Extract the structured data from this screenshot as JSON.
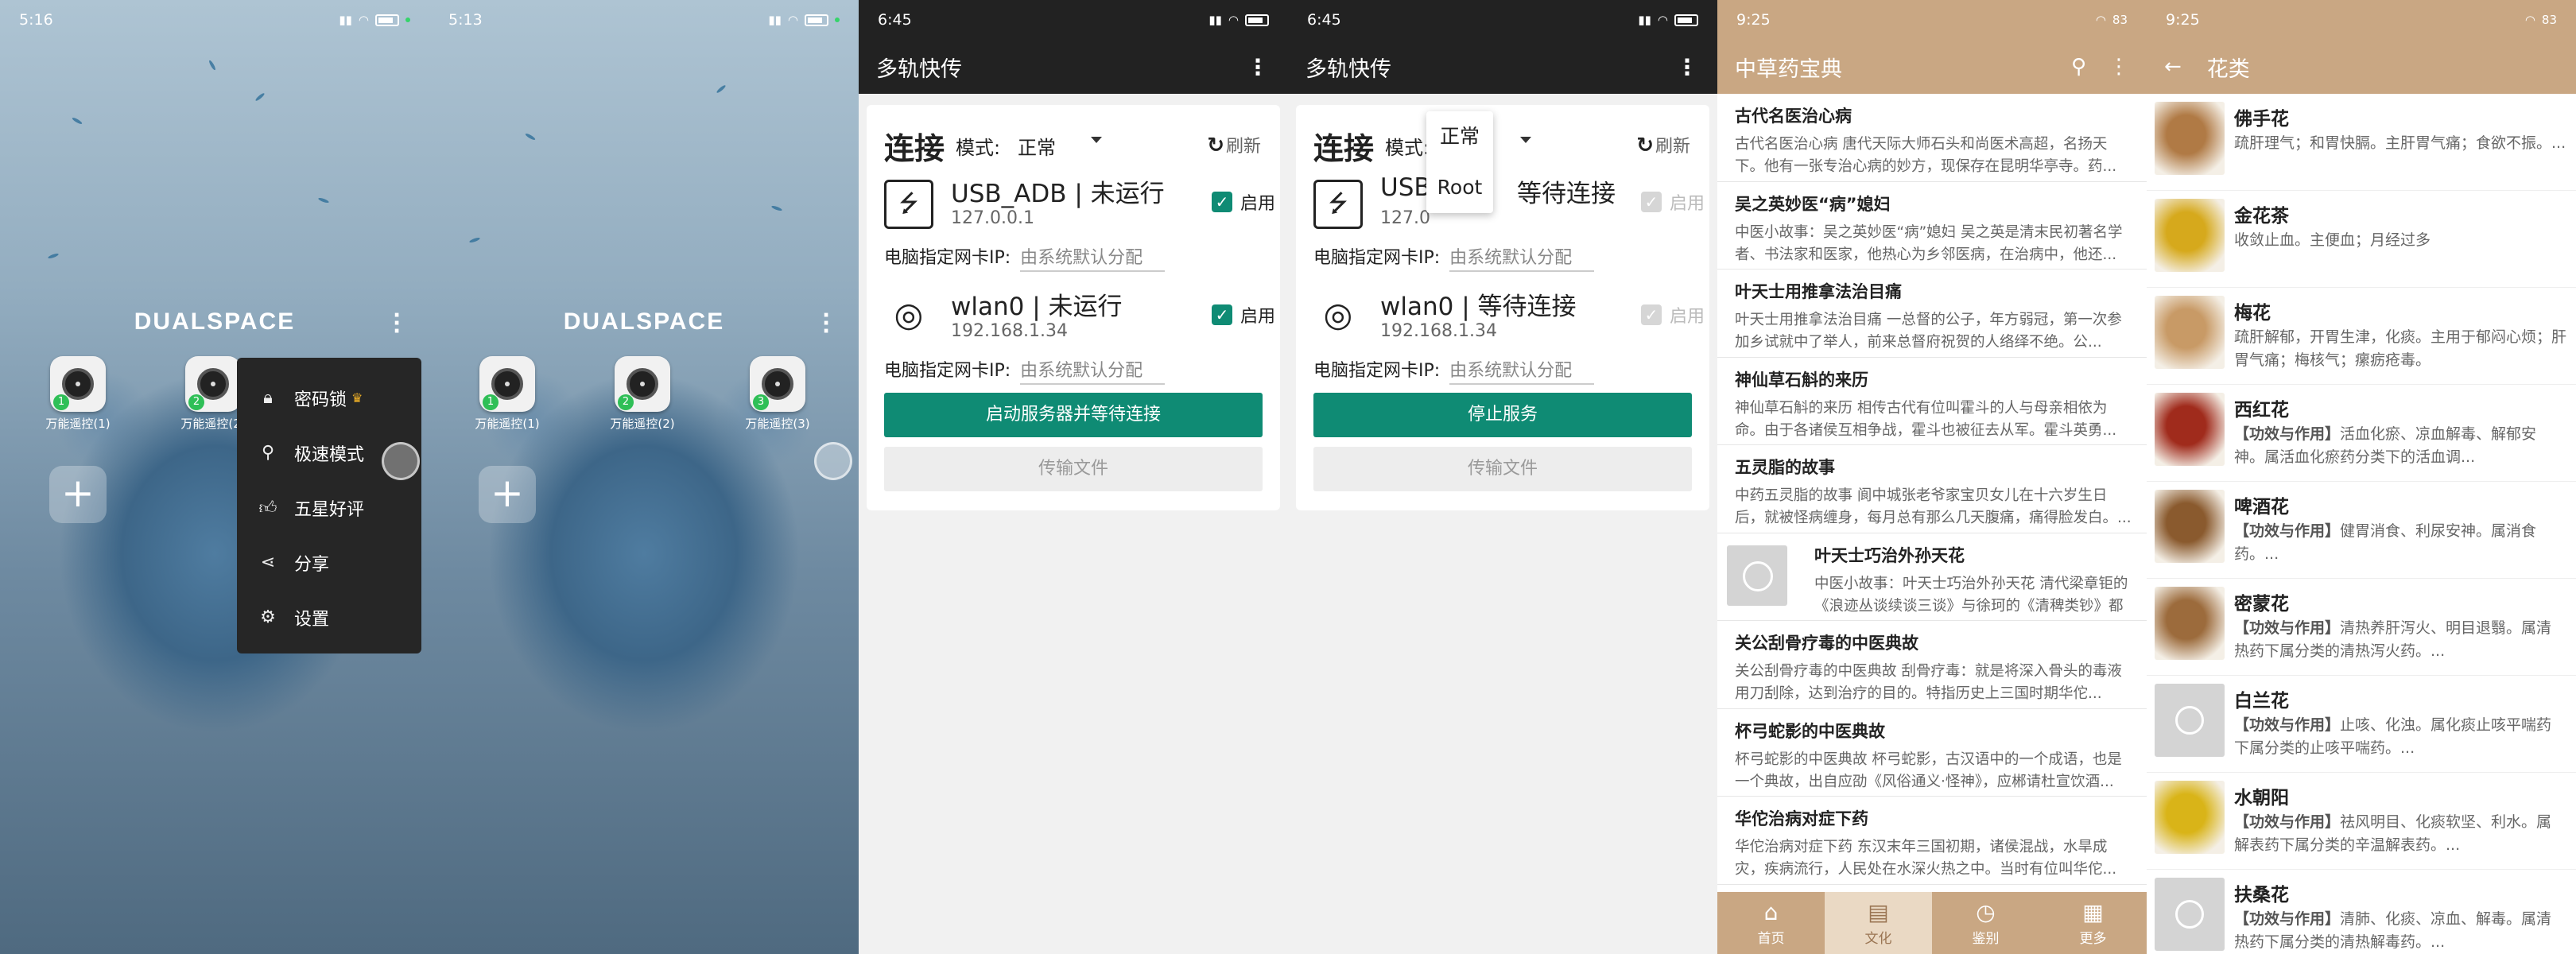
{
  "ds1": {
    "status_time": "5:16",
    "title": "DUALSPACE",
    "apps": [
      "万能遥控(1)",
      "万能遥控(2)"
    ],
    "badges": [
      "1",
      "2"
    ],
    "menu": [
      {
        "label": "密码锁",
        "icon": "lock-icon"
      },
      {
        "label": "极速模式",
        "icon": "rocket-icon"
      },
      {
        "label": "五星好评",
        "icon": "thumbs-up-icon"
      },
      {
        "label": "分享",
        "icon": "share-icon"
      },
      {
        "label": "设置",
        "icon": "settings-icon"
      }
    ]
  },
  "ds2": {
    "status_time": "5:13",
    "title": "DUALSPACE",
    "apps": [
      "万能遥控(1)",
      "万能遥控(2)",
      "万能遥控(3)"
    ],
    "badges": [
      "1",
      "2",
      "3"
    ]
  },
  "mt1": {
    "status_time": "6:45",
    "app_title": "多轨快传",
    "conn_title": "连接",
    "mode_label": "模式:",
    "mode_value": "正常",
    "refresh": "刷新",
    "usb": {
      "name": "USB_ADB | 未运行",
      "ip": "127.0.0.1",
      "enable": "启用"
    },
    "wlan": {
      "name": "wlan0 | 未运行",
      "ip": "192.168.1.34",
      "enable": "启用"
    },
    "nic_label": "电脑指定网卡IP:",
    "nic_value": "由系统默认分配",
    "primary_button": "启动服务器并等待连接",
    "secondary_button": "传输文件"
  },
  "mt2": {
    "status_time": "6:45",
    "app_title": "多轨快传",
    "conn_title": "连接",
    "mode_label": "模式:",
    "refresh": "刷新",
    "mode_options": [
      "正常",
      "Root"
    ],
    "usb": {
      "name_prefix": "USB_",
      "name_suffix": "等待连接",
      "ip": "127.0",
      "enable": "启用"
    },
    "wlan": {
      "name": "wlan0 | 等待连接",
      "ip": "192.168.1.34",
      "enable": "启用"
    },
    "nic_label": "电脑指定网卡IP:",
    "nic_value": "由系统默认分配",
    "primary_button": "停止服务",
    "secondary_button": "传输文件"
  },
  "herb1": {
    "status_time": "9:25",
    "status_batt": "83",
    "app_title": "中草药宝典",
    "articles": [
      {
        "title": "古代名医治心病",
        "desc": "古代名医治心病 唐代天际大师石头和尚医术高超，名扬天下。他有一张专治心病的妙方，现保存在昆明华亭寺。药..."
      },
      {
        "title": "吴之英妙医“病”媳妇",
        "desc": "中医小故事：吴之英妙医“病”媳妇 吴之英是清末民初著名学者、书法家和医家，他热心为乡邻医病，在治病中，他还..."
      },
      {
        "title": "叶天士用推拿法治目痛",
        "desc": "叶天士用推拿法治目痛 一总督的公子，年方弱冠，第一次参加乡试就中了举人，前来总督府祝贺的人络绎不绝。公..."
      },
      {
        "title": "神仙草石斛的来历",
        "desc": "神仙草石斛的来历 相传古代有位叫霍斗的人与母亲相依为命。由于各诸侯互相争战，霍斗也被征去从军。霍斗英勇..."
      },
      {
        "title": "五灵脂的故事",
        "desc": "中药五灵脂的故事 阆中城张老爷家宝贝女儿在十六岁生日后，就被怪病缠身，每月总有那么几天腹痛，痛得脸发白。..."
      },
      {
        "title": "叶天士巧治外孙天花",
        "desc": "中医小故事：叶天士巧治外孙天花 清代梁章钜的《浪迹丛谈续谈三谈》与徐珂的《清稗类钞》都记..."
      },
      {
        "title": "关公刮骨疗毒的中医典故",
        "desc": "关公刮骨疗毒的中医典故 刮骨疗毒：就是将深入骨头的毒液用刀刮除，达到治疗的目的。特指历史上三国时期华佗..."
      },
      {
        "title": "杯弓蛇影的中医典故",
        "desc": "杯弓蛇影的中医典故 杯弓蛇影，古汉语中的一个成语，也是一个典故，出自应劭《风俗通义·怪神》，应郴请杜宣饮酒..."
      },
      {
        "title": "华佗治病对症下药",
        "desc": "华佗治病对症下药 东汉末年三国初期，诸侯混战，水旱成灾，疾病流行，人民处在水深火热之中。当时有位叫华佗..."
      }
    ],
    "tabs": [
      {
        "label": "首页",
        "icon": "home-icon"
      },
      {
        "label": "文化",
        "icon": "book-icon"
      },
      {
        "label": "鉴别",
        "icon": "compass-icon"
      },
      {
        "label": "更多",
        "icon": "grid-icon"
      }
    ]
  },
  "herb2": {
    "status_time": "9:25",
    "status_batt": "83",
    "app_title": "花类",
    "flowers": [
      {
        "name": "佛手花",
        "effect_tag": "",
        "desc": "疏肝理气；和胃快膈。主肝胃气痛；食欲不振。...",
        "color": "#b07a45"
      },
      {
        "name": "金花茶",
        "effect_tag": "",
        "desc": "收敛止血。主便血；月经过多",
        "color": "#d6a91c"
      },
      {
        "name": "梅花",
        "effect_tag": "",
        "desc": "疏肝解郁，开胃生津，化痰。主用于郁闷心烦；肝胃气痛；梅核气；瘰疬疮毒。",
        "color": "#c89a66"
      },
      {
        "name": "西红花",
        "effect_tag": "【功效与作用】",
        "desc": "活血化瘀、凉血解毒、解郁安神。属活血化瘀药分类下的活血调...",
        "color": "#a02b1c"
      },
      {
        "name": "啤酒花",
        "effect_tag": "【功效与作用】",
        "desc": "健胃消食、利尿安神。属消食药。...",
        "color": "#8a5a2e"
      },
      {
        "name": "密蒙花",
        "effect_tag": "【功效与作用】",
        "desc": "清热养肝泻火、明目退翳。属清热药下属分类的清热泻火药。...",
        "color": "#9c6b3c"
      },
      {
        "name": "白兰花",
        "effect_tag": "【功效与作用】",
        "desc": "止咳、化浊。属化痰止咳平喘药下属分类的止咳平喘药。...",
        "color": ""
      },
      {
        "name": "水朝阳",
        "effect_tag": "【功效与作用】",
        "desc": "祛风明目、化痰软坚、利水。属解表药下属分类的辛温解表药。...",
        "color": "#d9b418"
      },
      {
        "name": "扶桑花",
        "effect_tag": "【功效与作用】",
        "desc": "清肺、化痰、凉血、解毒。属清热药下属分类的清热解毒药。...",
        "color": ""
      }
    ]
  }
}
